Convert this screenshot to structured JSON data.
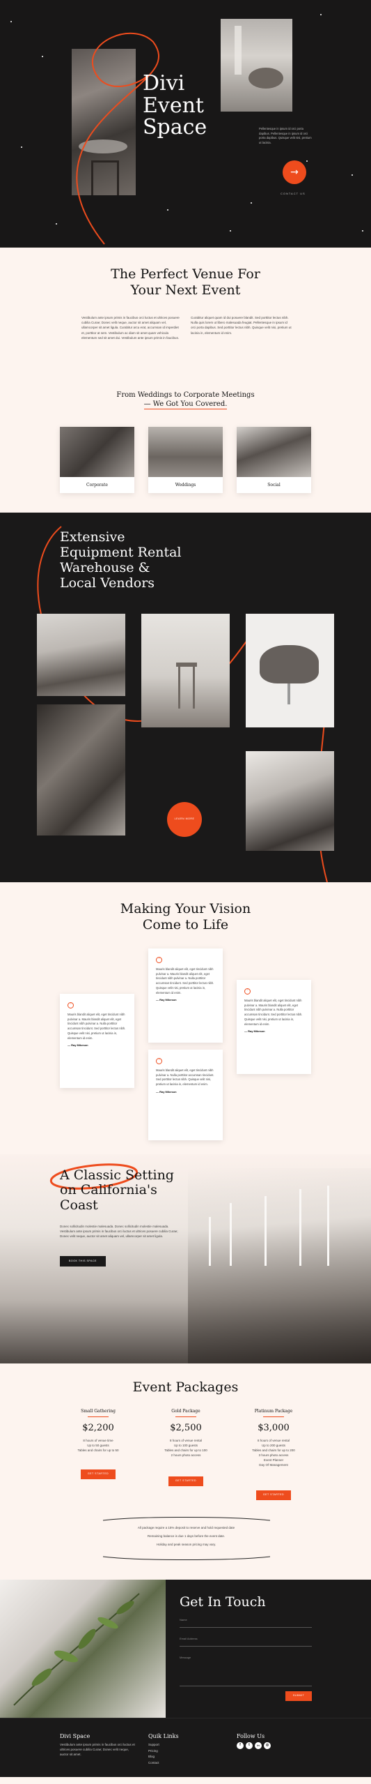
{
  "hero": {
    "title_lines": [
      "Divi",
      "Event",
      "Space"
    ],
    "text": "Pellentesque in ipsum id orci porta dapibus. Pellentesque in ipsum id orci porta dapibus. Quisque velit nisi, pretium ut lacinia.",
    "contact_label": "CONTACT US",
    "arrow": "→"
  },
  "venue": {
    "title_lines": [
      "The Perfect Venue For",
      "Your Next Event"
    ],
    "col1": "Vestibulum ante ipsum primis in faucibus orci luctus et ultrices posuere cubilia Curae; Donec velit neque, auctor sit amet aliquam vel, ullamcorper sit amet ligula. Curabitur arcu erat, accumsan id imperdiet et, porttitor at sem. Vestibulum ac diam sit amet quam vehicula elementum sed sit amet dui. Vestibulum ante ipsum primis in faucibus.",
    "col2": "Curabitur aliquet quam id dui posuere blandit. Sed porttitor lectus nibh. Nulla quis lorem ut libero malesuada feugiat. Pellentesque in ipsum id orci porta dapibus. Sed porttitor lectus nibh. Quisque velit nisi, pretium ut lacinia in, elementum id enim."
  },
  "occasions": {
    "heading_line1": "From Weddings to Corporate Meetings",
    "heading_line2": "— We Got You Covered.",
    "cards": [
      {
        "label": "Corporate"
      },
      {
        "label": "Weddings"
      },
      {
        "label": "Social"
      }
    ]
  },
  "rental": {
    "title_lines": [
      "Extensive",
      "Equipment Rental",
      "Warehouse &",
      "Local Vendors"
    ],
    "button": "LEARN MORE"
  },
  "vision": {
    "title_lines": [
      "Making Your Vision",
      "Come to Life"
    ],
    "testimonials": [
      {
        "text": "Mauris blandit aliquet elit, eget tincidunt nibh pulvinar a. Mauris blandit aliquet elit, eget tincidunt nibh pulvinar a. Nulla porttitor accumsan tincidunt. Sed porttitor lectus nibh. Quisque velit nisi, pretium ut lacinia in, elementum id enim.",
        "author": "— Ray Mikeson"
      },
      {
        "text": "Mauris blandit aliquet elit, eget tincidunt nibh pulvinar a. Mauris blandit aliquet elit, eget tincidunt nibh pulvinar a. Nulla porttitor accumsan tincidunt. Sed porttitor lectus nibh. Quisque velit nisi, pretium ut lacinia in, elementum id enim.",
        "author": "— Ray Mikeson"
      },
      {
        "text": "Mauris blandit aliquet elit, eget tincidunt nibh pulvinar a. Mauris blandit aliquet elit, eget tincidunt nibh pulvinar a. Nulla porttitor accumsan tincidunt. Sed porttitor lectus nibh. Quisque velit nisi, pretium ut lacinia in, elementum id enim.",
        "author": "— Ray Mikeson"
      },
      {
        "text": "Mauris blandit aliquet elit, eget tincidunt nibh pulvinar a. Nulla porttitor accumsan tincidunt. Sed porttitor lectus nibh. Quisque velit nisi, pretium ut lacinia in, elementum id enim.",
        "author": "— Ray Mikeson"
      }
    ],
    "quote_mark": "“"
  },
  "classic": {
    "title_lines": [
      "A Classic Setting",
      "on California's",
      "Coast"
    ],
    "text": "Donec sollicitudin molestie malesuada. Donec sollicitudin molestie malesuada. Vestibulum ante ipsum primis in faucibus orci luctus et ultrices posuere cubilia Curae; Donec velit neque, auctor sit amet aliquam vel, ullamcorper sit amet ligula.",
    "button": "BOOK THIS SPACE"
  },
  "packages": {
    "title": "Event Packages",
    "plans": [
      {
        "name": "Small Gathering",
        "price": "$2,200",
        "features": [
          "8 hours of venue time",
          "Up to 50 guests",
          "Tables and chairs for up to 50"
        ],
        "button": "GET STARTED"
      },
      {
        "name": "Gold Package",
        "price": "$2,500",
        "features": [
          "8 hours of venue rental",
          "Up to 100 guests",
          "Tables and chairs for up to 100",
          "2 hours photo access"
        ],
        "button": "GET STARTED"
      },
      {
        "name": "Platinum Package",
        "price": "$3,000",
        "features": [
          "8 hours of venue rental",
          "Up to 200 guests",
          "Tables and chairs for up to 200",
          "3 hours photo access",
          "Event Planner",
          "Day Of Management"
        ],
        "button": "GET STARTED"
      }
    ],
    "notes": [
      "All package require a 15% deposit to reserve and hold requested date",
      "Remaining balance is due 1 days before the event date.",
      "Holiday and peak season pricing may vary."
    ]
  },
  "contact": {
    "title": "Get In Touch",
    "fields": [
      "Name",
      "Email Address",
      "Message"
    ],
    "submit": "SUBMIT"
  },
  "footer": {
    "brand": "Divi Space",
    "brand_text": "Vestibulum ante ipsum primis in faucibus orci luctus et ultrices posuere cubilia Curae; Donec velit neque, auctor sit amet.",
    "links_title": "Quik Links",
    "links": [
      "Support",
      "Pricing",
      "Blog",
      "Contact"
    ],
    "follow_title": "Follow Us",
    "social": [
      "f",
      "t",
      "in",
      "◎"
    ]
  },
  "colors": {
    "accent": "#ee4c1d",
    "dark": "#1a1919",
    "cream": "#fdf4ef"
  }
}
